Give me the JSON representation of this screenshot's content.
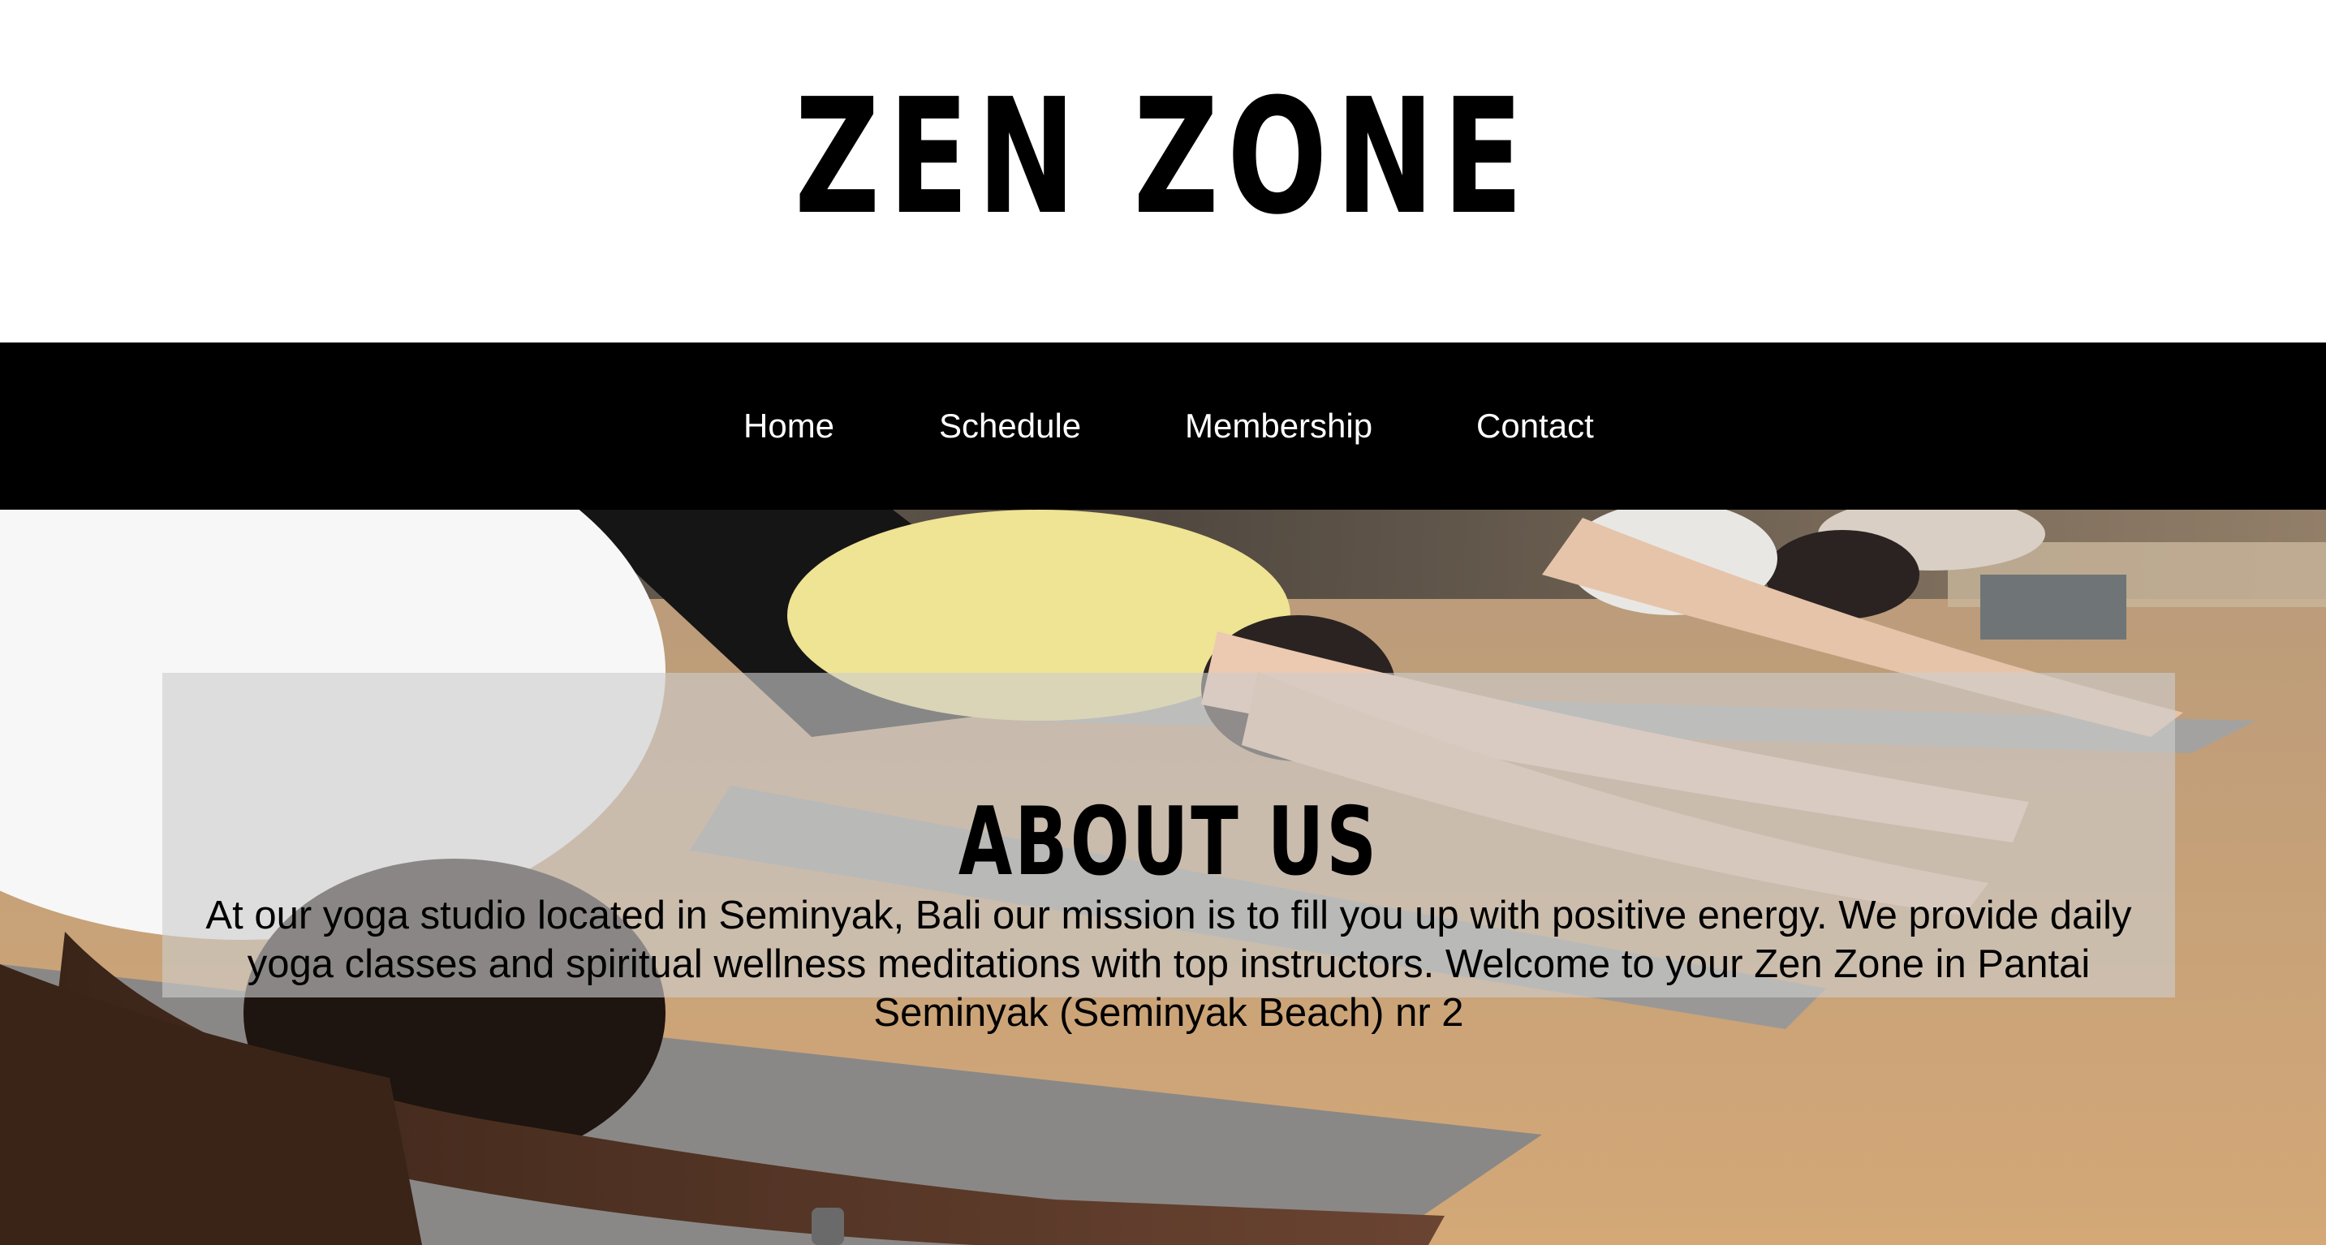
{
  "header": {
    "logo_text": "ZEN ZONE"
  },
  "nav": {
    "items": [
      {
        "label": "Home"
      },
      {
        "label": "Schedule"
      },
      {
        "label": "Membership"
      },
      {
        "label": "Contact"
      }
    ]
  },
  "about": {
    "title": "ABOUT US",
    "text": "At our yoga studio located in Seminyak, Bali our mission is to fill you up with positive energy. We provide daily yoga classes and spiritual wellness meditations with top instructors. Welcome to your Zen Zone in Pantai Seminyak (Seminyak Beach) nr 2"
  },
  "colors": {
    "nav_background": "#000000",
    "nav_text": "#ffffff",
    "header_background": "#ffffff",
    "panel_overlay": "#cdcdcd"
  }
}
